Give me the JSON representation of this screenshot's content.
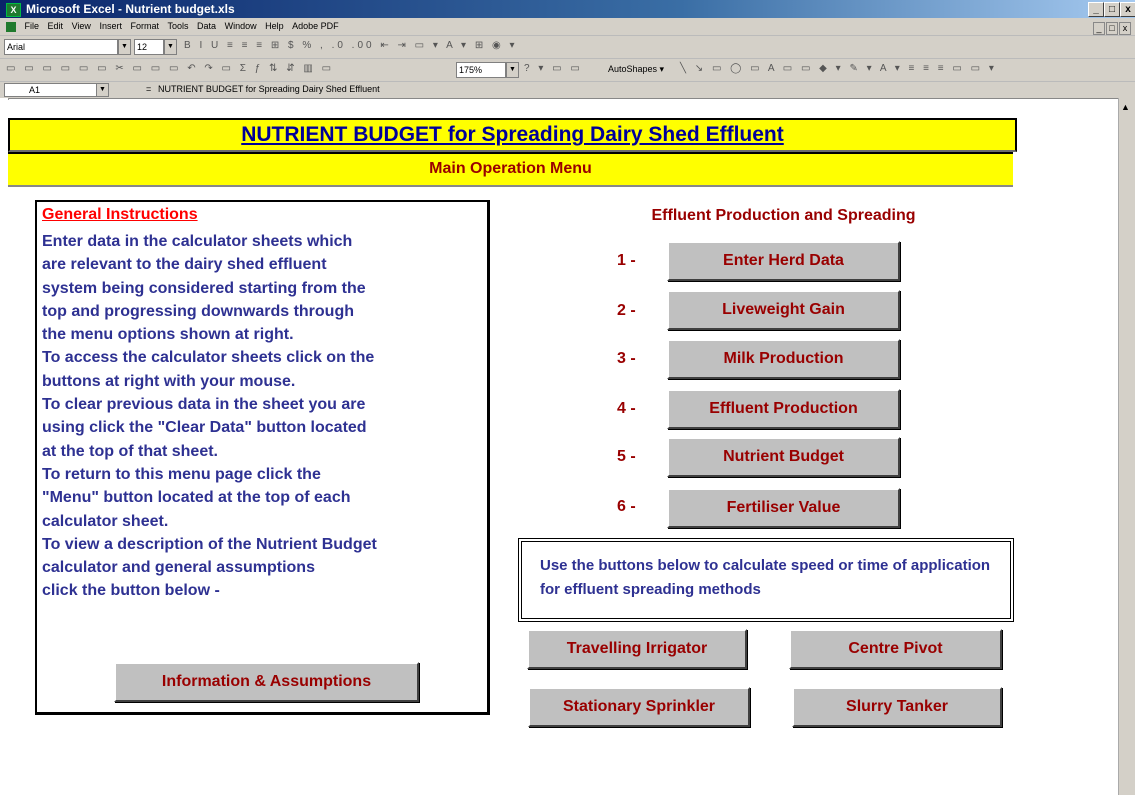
{
  "window": {
    "title": "Microsoft Excel - Nutrient budget.xls",
    "min_btn": "_",
    "max_btn": "ͦ",
    "close_btn": "x"
  },
  "menubar": {
    "items": [
      "File",
      "Edit",
      "View",
      "Insert",
      "Format",
      "Tools",
      "Data",
      "Window",
      "Help",
      "Adobe PDF"
    ]
  },
  "format_toolbar": {
    "font_name": "Arial",
    "font_size": "12"
  },
  "standard_toolbar": {
    "zoom": "175%",
    "autoshapes_label": "AutoShapes ▾"
  },
  "formula_bar": {
    "cell_ref": "A1",
    "equals": "=",
    "formula": "NUTRIENT BUDGET for Spreading Dairy Shed Effluent"
  },
  "sheet": {
    "title": "NUTRIENT BUDGET for Spreading Dairy Shed Effluent",
    "subtitle": "Main Operation Menu",
    "instructions": {
      "heading": "General Instructions",
      "lines": [
        "Enter data in the calculator sheets which",
        "are relevant to the dairy shed effluent",
        "system being considered starting from the",
        "top and progressing downwards through",
        "the menu options shown at right.",
        "To access the calculator sheets click on the",
        "buttons at right with your mouse.",
        "To clear previous data in the sheet you are",
        "using click the \"Clear Data\" button located",
        "at the top of that sheet.",
        "To return to this menu page click the",
        "\"Menu\" button located at the top of each",
        "calculator sheet.",
        "To view a description of the Nutrient Budget",
        "calculator and general assumptions",
        "click the button below -"
      ],
      "info_button": "Information & Assumptions"
    },
    "effluent": {
      "heading": "Effluent Production and Spreading",
      "steps": [
        {
          "num": "1 -",
          "label": "Enter Herd Data"
        },
        {
          "num": "2 -",
          "label": "Liveweight Gain"
        },
        {
          "num": "3 -",
          "label": "Milk Production"
        },
        {
          "num": "4 -",
          "label": "Effluent Production"
        },
        {
          "num": "5 -",
          "label": "Nutrient Budget"
        },
        {
          "num": "6 -",
          "label": "Fertiliser Value"
        }
      ]
    },
    "calc_note": "Use the buttons below to calculate speed or time of application for effluent spreading methods",
    "methods": {
      "travelling": "Travelling Irrigator",
      "pivot": "Centre Pivot",
      "sprinkler": "Stationary Sprinkler",
      "tanker": "Slurry Tanker"
    }
  }
}
